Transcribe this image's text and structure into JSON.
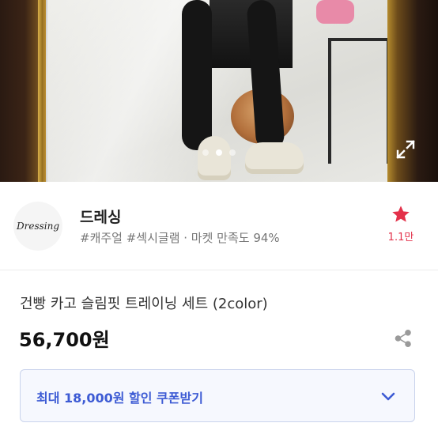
{
  "product_image": {
    "expand_icon": "expand-icon",
    "carousel_dots": 3,
    "active_dot": 1
  },
  "shop": {
    "logo_text": "Dressing",
    "name": "드레싱",
    "tags": "#캐주얼 #섹시글램 · 마켓 만족도 94%",
    "favorite_icon": "star-icon",
    "favorite_color": "#e3314a",
    "favorite_count": "1.1만"
  },
  "product": {
    "title": "건빵 카고 슬림핏 트레이닝 세트 (2color)",
    "price": "56,700원",
    "share_icon": "share-icon"
  },
  "coupon": {
    "label": "최대 18,000원 할인 쿠폰받기",
    "accent_color": "#3d5bd4",
    "icon": "chevron-down-icon"
  }
}
